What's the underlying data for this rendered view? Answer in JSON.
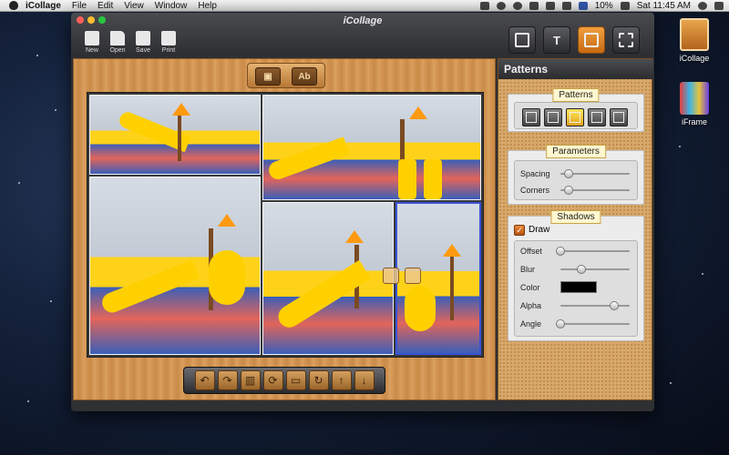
{
  "menubar": {
    "app_name": "iCollage",
    "items": [
      "File",
      "Edit",
      "View",
      "Window",
      "Help"
    ],
    "battery": "10%",
    "clock": "Sat 11:45 AM"
  },
  "desktop": {
    "icons": [
      {
        "label": "iCollage",
        "icon": "icollage-app-icon"
      },
      {
        "label": "iFrame",
        "icon": "iframe-app-icon"
      }
    ]
  },
  "window": {
    "title": "iCollage",
    "toolbar": {
      "new_label": "New",
      "open_label": "Open",
      "save_label": "Save",
      "print_label": "Print"
    },
    "mode_buttons": {
      "text_glyph": "T"
    },
    "canvas": {
      "add_text_label": "Ab"
    }
  },
  "panel": {
    "title": "Patterns",
    "patterns_section": {
      "label": "Patterns"
    },
    "parameters_section": {
      "label": "Parameters",
      "spacing_label": "Spacing",
      "spacing_value": 0.12,
      "corners_label": "Corners",
      "corners_value": 0.12
    },
    "shadows_section": {
      "label": "Shadows",
      "draw_label": "Draw",
      "draw_checked": true,
      "offset_label": "Offset",
      "offset_value": 0.0,
      "blur_label": "Blur",
      "blur_value": 0.3,
      "color_label": "Color",
      "color_value": "#000000",
      "alpha_label": "Alpha",
      "alpha_value": 0.78,
      "angle_label": "Angle",
      "angle_value": 0.0
    }
  },
  "colors": {
    "accent": "#e8901f",
    "selection": "#3a52d6"
  }
}
